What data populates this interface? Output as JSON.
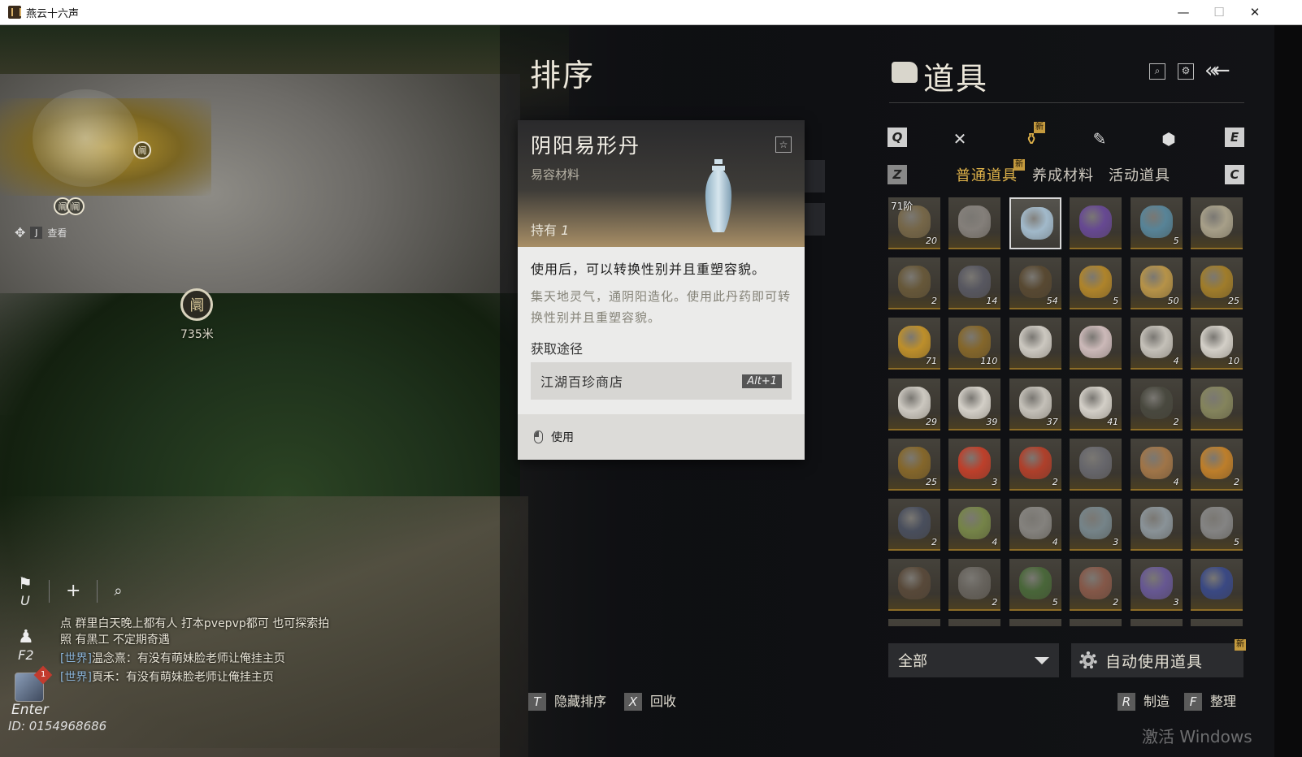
{
  "window": {
    "title": "燕云十六声",
    "minimize": "—",
    "maximize": "☐",
    "close": "✕"
  },
  "minimap": {
    "marker_labels": [
      "阛",
      "阛",
      "阛"
    ],
    "view_key": "J",
    "view_label": "查看"
  },
  "waypoint": {
    "symbol": "阛",
    "distance": "735米"
  },
  "hud": {
    "mark_key": "U",
    "add_symbol": "+",
    "search_symbol": "⌕",
    "social_key": "F2",
    "chat_key": "Enter",
    "uid": "ID: 0154968686",
    "avatar_badge": "1"
  },
  "chat": [
    {
      "channel": "",
      "text": "点 群里白天晚上都有人 打本pvepvp都可 也可探索拍照 有黑工 不定期奇遇"
    },
    {
      "channel": "[世界]",
      "text": "温念熹：有没有萌妹脸老师让俺挂主页"
    },
    {
      "channel": "[世界]",
      "text": "頁禾：有没有萌妹脸老师让俺挂主页"
    }
  ],
  "sort_panel": {
    "title": "排序",
    "hide_key": "T",
    "hide_label": "隐藏排序",
    "recycle_key": "X",
    "recycle_label": "回收"
  },
  "tooltip": {
    "name": "阴阳易形丹",
    "category": "易容材料",
    "hold_label": "持有",
    "hold_count": "1",
    "fav_icon": "☆",
    "usage": "使用后，可以转换性别并且重塑容貌。",
    "description": "集天地灵气，通阴阳造化。使用此丹药即可转换性别并且重塑容貌。",
    "source_heading": "获取途径",
    "source": "江湖百珍商店",
    "source_hotkey": "Alt+1",
    "use_label": "使用"
  },
  "inventory": {
    "title": "道具",
    "search_icon": "⌕",
    "settings_icon": "⚙",
    "back_icon": "«←",
    "prev_cat_key": "Q",
    "next_cat_key": "E",
    "prev_sub_key": "Z",
    "next_sub_key": "C",
    "new_tag": "新",
    "category_icons": [
      "✕",
      "♝",
      "✎",
      "⬢"
    ],
    "subtabs": [
      "普通道具",
      "养成材料",
      "活动道具"
    ],
    "filter_value": "全部",
    "auto_use_label": "自动使用道具",
    "craft_key": "R",
    "craft_label": "制造",
    "organize_key": "F",
    "organize_label": "整理",
    "accent": "#e0b34a",
    "items": [
      {
        "icon": "gold-ingot-box-icon",
        "count": "20",
        "tier": "71阶",
        "color": "#7a6a4a"
      },
      {
        "icon": "brush-scroll-icon",
        "count": "",
        "color": "#8a8580"
      },
      {
        "icon": "porcelain-vase-icon",
        "count": "",
        "color": "#a9c3d6",
        "selected": true
      },
      {
        "icon": "purple-gem-icon",
        "count": "",
        "color": "#6a4a9a"
      },
      {
        "icon": "jeweled-box-icon",
        "count": "5",
        "color": "#5a8aa0"
      },
      {
        "icon": "book-icon",
        "count": "",
        "color": "#b0a890"
      },
      {
        "icon": "hammer-icon",
        "count": "2",
        "color": "#6a5a3a"
      },
      {
        "icon": "badge-icon",
        "count": "14",
        "color": "#5a5a64"
      },
      {
        "icon": "bell-icon",
        "count": "54",
        "color": "#5a4a32"
      },
      {
        "icon": "golden-orb-icon",
        "count": "5",
        "color": "#b88a2a"
      },
      {
        "icon": "golden-fish-icon",
        "count": "50",
        "color": "#c09a4a"
      },
      {
        "icon": "gold-ring-icon",
        "count": "25",
        "color": "#a8822a"
      },
      {
        "icon": "gold-boat-icon",
        "count": "71",
        "color": "#c8962a"
      },
      {
        "icon": "copper-coin-icon",
        "count": "110",
        "color": "#8a6a2a"
      },
      {
        "icon": "bowl-icon",
        "count": "",
        "color": "#d8d4cc"
      },
      {
        "icon": "bowl-icon",
        "count": "",
        "color": "#d8c4c4"
      },
      {
        "icon": "bowl-icon",
        "count": "4",
        "color": "#d0ccc4"
      },
      {
        "icon": "bowl-icon",
        "count": "10",
        "color": "#e0dcd4"
      },
      {
        "icon": "bowl-icon",
        "count": "29",
        "color": "#d8d4cc"
      },
      {
        "icon": "lidded-bowl-icon",
        "count": "39",
        "color": "#e0dcd4"
      },
      {
        "icon": "plate-icon",
        "count": "37",
        "color": "#d0ccc4"
      },
      {
        "icon": "bowl-icon",
        "count": "41",
        "color": "#e0dcd4"
      },
      {
        "icon": "incense-icon",
        "count": "2",
        "color": "#4a4a40"
      },
      {
        "icon": "gourd-icon",
        "count": "",
        "color": "#8a8a60"
      },
      {
        "icon": "beetle-icon",
        "count": "25",
        "color": "#8a6a2a"
      },
      {
        "icon": "red-crab-icon",
        "count": "3",
        "color": "#c8402a"
      },
      {
        "icon": "red-lobster-icon",
        "count": "2",
        "color": "#b8402a"
      },
      {
        "icon": "bird-icon",
        "count": "",
        "color": "#6a6a70"
      },
      {
        "icon": "fish-icon",
        "count": "4",
        "color": "#a87a4a"
      },
      {
        "icon": "pumpkin-icon",
        "count": "2",
        "color": "#c8842a"
      },
      {
        "icon": "pangolin-icon",
        "count": "2",
        "color": "#4a5060"
      },
      {
        "icon": "cicada-icon",
        "count": "4",
        "color": "#7a8a4a"
      },
      {
        "icon": "stone-icon",
        "count": "4",
        "color": "#8a8884"
      },
      {
        "icon": "stone-icon",
        "count": "3",
        "color": "#7a8a90"
      },
      {
        "icon": "stone-icon",
        "count": "",
        "color": "#909aa0"
      },
      {
        "icon": "stone-icon",
        "count": "5",
        "color": "#8a8a8a"
      },
      {
        "icon": "rat-icon",
        "count": "",
        "color": "#5a4a3a"
      },
      {
        "icon": "pinecone-icon",
        "count": "2",
        "color": "#6a6660"
      },
      {
        "icon": "grasshopper-icon",
        "count": "5",
        "color": "#4a6a3a"
      },
      {
        "icon": "dragonfly-icon",
        "count": "2",
        "color": "#8a5a4a"
      },
      {
        "icon": "butterfly-icon",
        "count": "3",
        "color": "#6a5a9a"
      },
      {
        "icon": "card-icon",
        "count": "",
        "color": "#3a4a8a"
      }
    ]
  }
}
